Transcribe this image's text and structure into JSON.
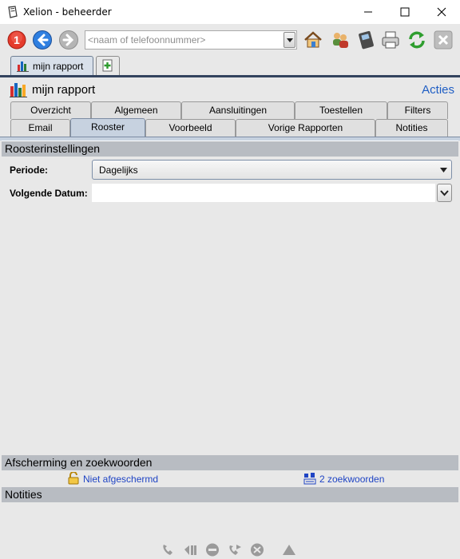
{
  "window": {
    "title": "Xelion - beheerder",
    "controls": [
      "minimize",
      "maximize",
      "close"
    ]
  },
  "toolbar": {
    "badge_number": "1",
    "search_placeholder": "<naam of telefoonnummer>",
    "icons": [
      "notification-badge-icon",
      "back-icon",
      "forward-icon",
      "home-icon",
      "contacts-icon",
      "phone-device-icon",
      "printer-icon",
      "refresh-icon",
      "close-document-icon"
    ]
  },
  "doc_tabs": {
    "active_label": "mijn rapport",
    "add_icon": "new-tab-icon"
  },
  "report": {
    "title": "mijn rapport",
    "actions_label": "Acties",
    "tabs_row1": [
      "Overzicht",
      "Algemeen",
      "Aansluitingen",
      "Toestellen",
      "Filters"
    ],
    "tabs_row2": [
      "Email",
      "Rooster",
      "Voorbeeld",
      "Vorige Rapporten",
      "Notities"
    ],
    "active_tab": "Rooster"
  },
  "schedule": {
    "header": "Roosterinstellingen",
    "period_label": "Periode:",
    "period_value": "Dagelijks",
    "next_date_label": "Volgende Datum:",
    "next_date_value": ""
  },
  "protection": {
    "header": "Afscherming en zoekwoorden",
    "lock_label": "Niet afgeschermd",
    "keywords_label": "2 zoekwoorden"
  },
  "notes": {
    "header": "Notities"
  },
  "statusbar": {
    "icons": [
      "call-icon",
      "hold-icon",
      "hangup-icon",
      "transfer-icon",
      "conference-icon",
      "alert-icon"
    ]
  },
  "colors": {
    "accent_link": "#1f5ec4",
    "tab_active": "#c7d2e0",
    "section_header": "#b8bcc2",
    "panel_bg": "#e8e8e8"
  }
}
